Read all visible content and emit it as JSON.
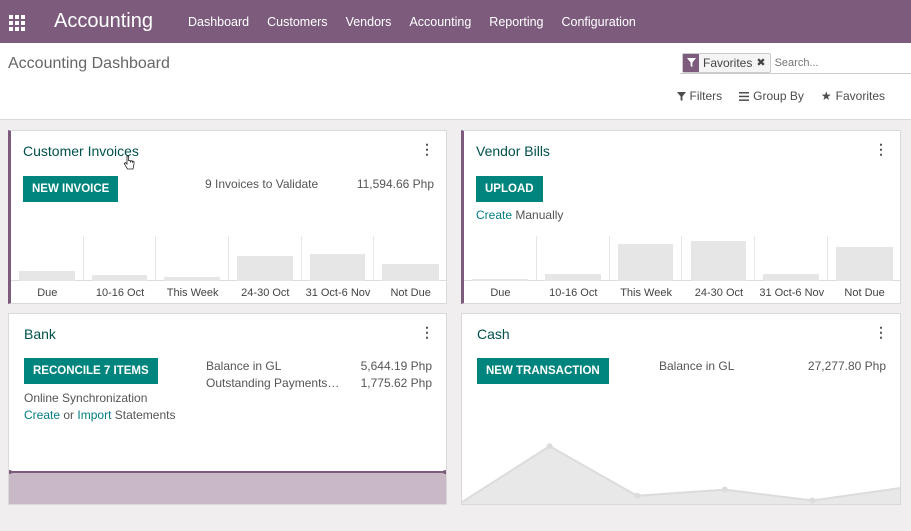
{
  "navbar": {
    "app_title": "Accounting",
    "menu": [
      "Dashboard",
      "Customers",
      "Vendors",
      "Accounting",
      "Reporting",
      "Configuration"
    ]
  },
  "control_panel": {
    "breadcrumb": "Accounting Dashboard",
    "facet_label": "Favorites",
    "search_placeholder": "Search...",
    "filters_label": "Filters",
    "groupby_label": "Group By",
    "favorites_label": "Favorites"
  },
  "customer_invoices": {
    "title": "Customer Invoices",
    "button": "NEW INVOICE",
    "to_validate": "9 Invoices to Validate",
    "amount": "11,594.66 Php",
    "chart": {
      "categories": [
        "Due",
        "10-16 Oct",
        "This Week",
        "24-30 Oct",
        "31 Oct-6 Nov",
        "Not Due"
      ],
      "values": [
        0.22,
        0.13,
        0.09,
        0.55,
        0.6,
        0.38
      ]
    }
  },
  "vendor_bills": {
    "title": "Vendor Bills",
    "button": "UPLOAD",
    "create_link": "Create",
    "create_suffix": "Manually",
    "chart": {
      "categories": [
        "Due",
        "10-16 Oct",
        "This Week",
        "24-30 Oct",
        "31 Oct-6 Nov",
        "Not Due"
      ],
      "values": [
        0.04,
        0.15,
        0.82,
        0.88,
        0.15,
        0.75
      ]
    }
  },
  "bank": {
    "title": "Bank",
    "button": "RECONCILE 7 ITEMS",
    "online_sync": "Online Synchronization",
    "create_link": "Create",
    "or_text": "or",
    "import_link": "Import",
    "statements_text": "Statements",
    "balance_label": "Balance in GL",
    "balance_value": "5,644.19 Php",
    "outstanding_label": "Outstanding Payments…",
    "outstanding_value": "1,775.62 Php"
  },
  "cash": {
    "title": "Cash",
    "button": "NEW TRANSACTION",
    "balance_label": "Balance in GL",
    "balance_value": "27,277.80 Php",
    "line_values": [
      0.0,
      0.72,
      0.08,
      0.16,
      0.02,
      0.18
    ]
  },
  "colors": {
    "brand": "#7c5b7c",
    "button": "#00847e",
    "bank_band": "#c9b8c6"
  }
}
